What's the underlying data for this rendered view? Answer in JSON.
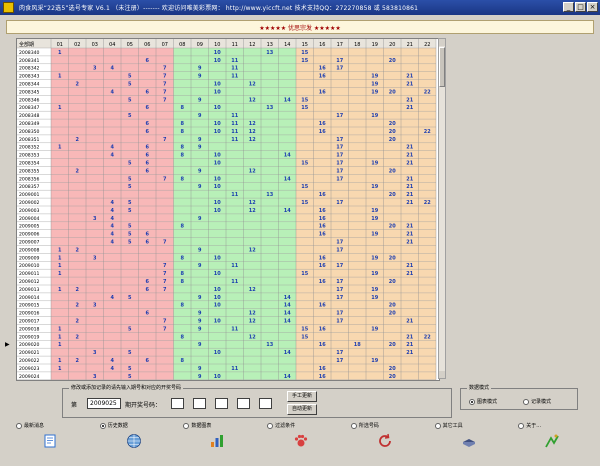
{
  "window": {
    "title": "肉食风采“22选5”选号专家 V6.1 （未注册）------- 欢迎访问唯美彩票网： http://www.yiccft.net  技术支持QQ：272270858 或 583810861",
    "minimize": "_",
    "maximize": "□",
    "close": "×"
  },
  "header": {
    "text": "★★★★★ 优思宗发 ★★★★★"
  },
  "grid": {
    "corner": "全部期",
    "columns": [
      "01",
      "02",
      "03",
      "04",
      "05",
      "06",
      "07",
      "08",
      "09",
      "10",
      "11",
      "12",
      "13",
      "14",
      "15",
      "16",
      "17",
      "18",
      "19",
      "20",
      "21",
      "22"
    ],
    "zones": [
      {
        "from": 1,
        "to": 7,
        "color": "#f8b8b8"
      },
      {
        "from": 8,
        "to": 14,
        "color": "#b8f0b8"
      },
      {
        "from": 15,
        "to": 22,
        "color": "#f8d8b0"
      }
    ],
    "rows": [
      {
        "period": "2008340",
        "nums": [
          1,
          10,
          13,
          15
        ]
      },
      {
        "period": "2008341",
        "nums": [
          6,
          10,
          11,
          15,
          17,
          20
        ]
      },
      {
        "period": "2008342",
        "nums": [
          3,
          4,
          7,
          9,
          11,
          16,
          17
        ]
      },
      {
        "period": "2008343",
        "nums": [
          1,
          5,
          7,
          9,
          11,
          16,
          19,
          21
        ]
      },
      {
        "period": "2008344",
        "nums": [
          2,
          5,
          7,
          10,
          12,
          19,
          21
        ]
      },
      {
        "period": "2008345",
        "nums": [
          4,
          6,
          7,
          10,
          16,
          19,
          20,
          22
        ]
      },
      {
        "period": "2008346",
        "nums": [
          5,
          7,
          9,
          12,
          14,
          15,
          21
        ]
      },
      {
        "period": "2008347",
        "nums": [
          1,
          6,
          8,
          10,
          13,
          15,
          21
        ]
      },
      {
        "period": "2008348",
        "nums": [
          5,
          9,
          11,
          17,
          19
        ]
      },
      {
        "period": "2008349",
        "nums": [
          6,
          8,
          10,
          11,
          12,
          16,
          20
        ]
      },
      {
        "period": "2008350",
        "nums": [
          6,
          8,
          10,
          11,
          12,
          16,
          20,
          22
        ]
      },
      {
        "period": "2008351",
        "nums": [
          2,
          7,
          9,
          11,
          12,
          17,
          20
        ]
      },
      {
        "period": "2008352",
        "nums": [
          1,
          4,
          6,
          8,
          9,
          17,
          21
        ]
      },
      {
        "period": "2008353",
        "nums": [
          4,
          6,
          8,
          10,
          14,
          17,
          21
        ]
      },
      {
        "period": "2008354",
        "nums": [
          5,
          6,
          10,
          15,
          17,
          19,
          21
        ]
      },
      {
        "period": "2008355",
        "nums": [
          2,
          6,
          9,
          12,
          17,
          20
        ]
      },
      {
        "period": "2008356",
        "nums": [
          5,
          7,
          8,
          10,
          14,
          17,
          21
        ]
      },
      {
        "period": "2008357",
        "nums": [
          5,
          9,
          10,
          15,
          19,
          21
        ]
      },
      {
        "period": "2009001",
        "nums": [
          11,
          13,
          16,
          20,
          21
        ]
      },
      {
        "period": "2009002",
        "nums": [
          4,
          5,
          10,
          12,
          15,
          17,
          21,
          22
        ]
      },
      {
        "period": "2009003",
        "nums": [
          4,
          5,
          10,
          12,
          14,
          16,
          19
        ]
      },
      {
        "period": "2009004",
        "nums": [
          3,
          4,
          9,
          16,
          19
        ]
      },
      {
        "period": "2009005",
        "nums": [
          4,
          5,
          8,
          16,
          20,
          21
        ]
      },
      {
        "period": "2009006",
        "nums": [
          4,
          5,
          6,
          16,
          19,
          21
        ]
      },
      {
        "period": "2009007",
        "nums": [
          4,
          5,
          6,
          7,
          17,
          21
        ]
      },
      {
        "period": "2009008",
        "nums": [
          1,
          2,
          9,
          12,
          17
        ]
      },
      {
        "period": "2009009",
        "nums": [
          1,
          3,
          8,
          10,
          16,
          19,
          20
        ]
      },
      {
        "period": "2009010",
        "nums": [
          1,
          7,
          9,
          11,
          16,
          17,
          21
        ]
      },
      {
        "period": "2009011",
        "nums": [
          1,
          7,
          8,
          10,
          15,
          19,
          21
        ]
      },
      {
        "period": "2009012",
        "nums": [
          6,
          7,
          8,
          11,
          16,
          17,
          20
        ]
      },
      {
        "period": "2009013",
        "nums": [
          1,
          2,
          6,
          7,
          10,
          12,
          17,
          19
        ]
      },
      {
        "period": "2009014",
        "nums": [
          4,
          5,
          9,
          10,
          14,
          17,
          19
        ]
      },
      {
        "period": "2009015",
        "nums": [
          2,
          3,
          8,
          10,
          14,
          16,
          20
        ]
      },
      {
        "period": "2009016",
        "nums": [
          6,
          9,
          12,
          14,
          17,
          20
        ]
      },
      {
        "period": "2009017",
        "nums": [
          2,
          7,
          9,
          10,
          12,
          14,
          17,
          21
        ]
      },
      {
        "period": "2009018",
        "nums": [
          1,
          5,
          7,
          9,
          11,
          15,
          16,
          19
        ]
      },
      {
        "period": "2009019",
        "nums": [
          1,
          2,
          8,
          12,
          15,
          21,
          22
        ]
      },
      {
        "period": "2009020",
        "nums": [
          1,
          9,
          13,
          16,
          18,
          20,
          21
        ]
      },
      {
        "period": "2009021",
        "nums": [
          3,
          5,
          10,
          14,
          17,
          21
        ]
      },
      {
        "period": "2009022",
        "nums": [
          1,
          2,
          4,
          6,
          8,
          17,
          19
        ]
      },
      {
        "period": "2009023",
        "nums": [
          1,
          4,
          5,
          9,
          11,
          16,
          20
        ]
      },
      {
        "period": "2009024",
        "nums": [
          3,
          5,
          9,
          10,
          14,
          16,
          20
        ]
      }
    ],
    "highlight": [
      {
        "row": 36,
        "col": 16
      }
    ]
  },
  "input_panel": {
    "legend": "修改或添加记录的请先输入期号和对应的开奖号码",
    "period_label": "第",
    "period_value": "2009025",
    "draw_label": "期开奖号码：",
    "manual_update": "手工更新",
    "auto_update": "自动更新"
  },
  "mode_panel": {
    "legend": "数据模式",
    "option_chart": "图表模式",
    "option_record": "记录模式",
    "selected": "option_chart"
  },
  "toolbar": {
    "items": [
      {
        "label": "最新消息",
        "icon": "page-icon",
        "color": "#2e6fd0"
      },
      {
        "label": "历史数据",
        "icon": "globe-icon",
        "color": "#6aa0d8"
      },
      {
        "label": "数据图表",
        "icon": "chart-icon",
        "color": "#e08020"
      },
      {
        "label": "过滤条件",
        "icon": "paw-icon",
        "color": "#d84040"
      },
      {
        "label": "所选号码",
        "icon": "refresh-icon",
        "color": "#c03030"
      },
      {
        "label": "其它工具",
        "icon": "book-icon",
        "color": "#405080"
      },
      {
        "label": "关于...",
        "icon": "info-icon",
        "color": "#30a030"
      }
    ],
    "selected": 1
  }
}
